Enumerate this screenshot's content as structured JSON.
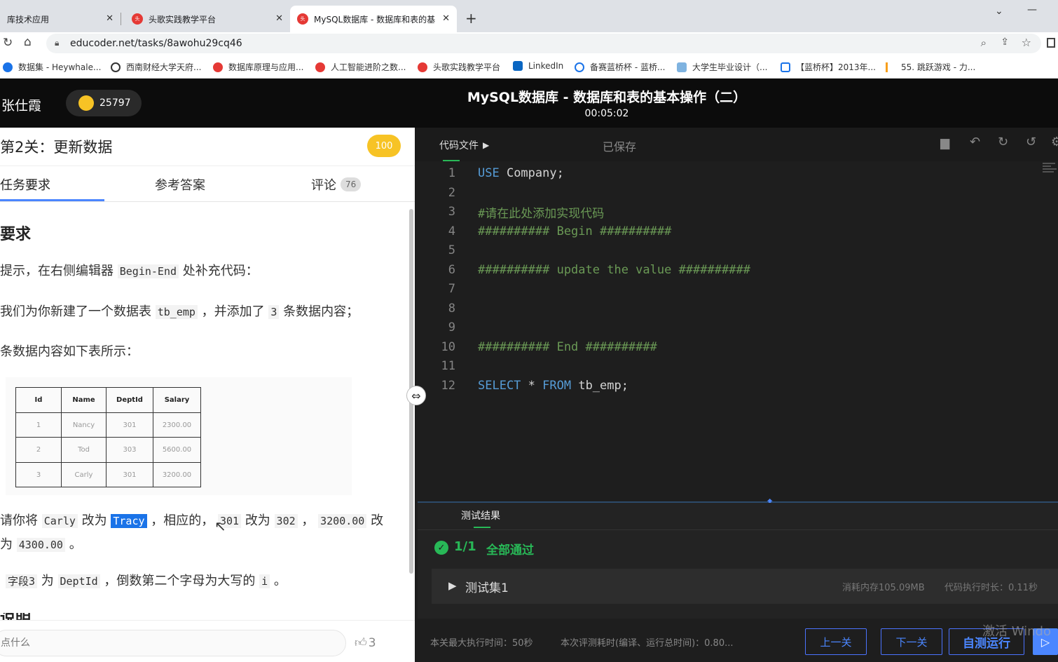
{
  "browser": {
    "tabs": [
      {
        "label": "库技术应用",
        "active": false
      },
      {
        "label": "头歌实践教学平台",
        "active": false
      },
      {
        "label": "MySQL数据库 - 数据库和表的基",
        "active": true
      }
    ],
    "new_tab": "+",
    "url": "educoder.net/tasks/8awohu29cq46",
    "bookmarks": [
      "数据集 - Heywhale...",
      "西南财经大学天府...",
      "数据库原理与应用...",
      "人工智能进阶之数...",
      "头歌实践教学平台",
      "LinkedIn",
      "备赛蓝桥杯 - 蓝桥...",
      "大学生毕业设计（...",
      "【蓝桥杯】2013年...",
      "55. 跳跃游戏 - 力..."
    ]
  },
  "header": {
    "username": "张仕霞",
    "coins": "25797",
    "title": "MySQL数据库 - 数据库和表的基本操作（二）",
    "timer": "00:05:02"
  },
  "task": {
    "level_title": "第2关：更新数据",
    "score": "100",
    "tabs": {
      "requirements": "任务要求",
      "answer": "参考答案",
      "comments": "评论",
      "comment_count": "76"
    },
    "section_title": "要求",
    "para1_a": "提示，在右侧编辑器",
    "para1_code": "Begin-End",
    "para1_b": "处补充代码：",
    "para2_a": "我们为你新建了一个数据表",
    "para2_code1": "tb_emp",
    "para2_b": "，并添加了",
    "para2_code2": "3",
    "para2_c": "条数据内容；",
    "para3": "条数据内容如下表所示：",
    "table": {
      "headers": [
        "Id",
        "Name",
        "DeptId",
        "Salary"
      ],
      "rows": [
        [
          "1",
          "Nancy",
          "301",
          "2300.00"
        ],
        [
          "2",
          "Tod",
          "303",
          "5600.00"
        ],
        [
          "3",
          "Carly",
          "301",
          "3200.00"
        ]
      ]
    },
    "para4_a": "请你将",
    "para4_code1": "Carly",
    "para4_b": "改为",
    "para4_code2": "Tracy",
    "para4_c": "，相应的，",
    "para4_code3": "301",
    "para4_d": "改为",
    "para4_code4": "302",
    "para4_e": "，",
    "para4_code5": "3200.00",
    "para4_f": "改",
    "para4_g": "为",
    "para4_code6": "4300.00",
    "para4_h": "。",
    "para5_code1": "字段3",
    "para5_a": "为",
    "para5_code2": "DeptId",
    "para5_b": "，倒数第二个字母为大写的",
    "para5_code3": "i",
    "para5_c": "。",
    "next_section": "说明",
    "comment_placeholder": "点什么",
    "like_count": "3"
  },
  "editor": {
    "file_label": "代码文件",
    "saved_label": "已保存",
    "lines": [
      {
        "n": "1",
        "parts": [
          {
            "t": "USE",
            "c": "kw"
          },
          {
            "t": " Company;",
            "c": "plain"
          }
        ]
      },
      {
        "n": "2",
        "parts": []
      },
      {
        "n": "3",
        "parts": [
          {
            "t": "#请在此处添加实现代码",
            "c": "cm"
          }
        ]
      },
      {
        "n": "4",
        "parts": [
          {
            "t": "########## Begin ##########",
            "c": "cm"
          }
        ]
      },
      {
        "n": "5",
        "parts": []
      },
      {
        "n": "6",
        "parts": [
          {
            "t": "########## update the value ##########",
            "c": "cm"
          }
        ]
      },
      {
        "n": "7",
        "parts": []
      },
      {
        "n": "8",
        "parts": []
      },
      {
        "n": "9",
        "parts": []
      },
      {
        "n": "10",
        "parts": [
          {
            "t": "########## End ##########",
            "c": "cm"
          }
        ]
      },
      {
        "n": "11",
        "parts": []
      },
      {
        "n": "12",
        "parts": [
          {
            "t": "SELECT",
            "c": "kw"
          },
          {
            "t": " * ",
            "c": "plain"
          },
          {
            "t": "FROM",
            "c": "kw"
          },
          {
            "t": " tb_emp;",
            "c": "plain"
          }
        ]
      }
    ]
  },
  "results": {
    "tab_label": "测试结果",
    "score": "1/1",
    "status": "全部通过",
    "testset": "测试集1",
    "memory": "消耗内存105.09MB",
    "exec_time": "代码执行时长：0.11秒",
    "max_time": "本关最大执行时间：50秒",
    "eval_time": "本次评测耗时(编译、运行总时间)：0.80...",
    "prev_btn": "上一关",
    "next_btn": "下一关",
    "run_btn": "自测运行",
    "watermark": "激活 Windo"
  },
  "colors": {
    "accent": "#4b86ff",
    "pass": "#28b857",
    "gold": "#f7c325"
  }
}
